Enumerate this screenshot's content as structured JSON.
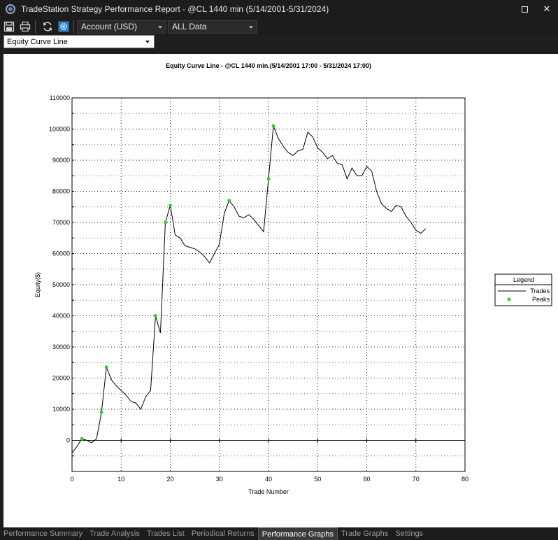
{
  "window": {
    "title": "TradeStation Strategy Performance Report - @CL 1440 min (5/14/2001-5/31/2024)",
    "maximize_icon": "maximize-icon",
    "close_glyph": "✕"
  },
  "toolbar": {
    "icons": [
      "save-icon",
      "print-icon",
      "refresh-icon",
      "settings-icon"
    ],
    "account_select": "Account (USD)",
    "data_range_select": "ALL Data"
  },
  "view_select": {
    "value": "Equity Curve Line"
  },
  "chart_data": {
    "type": "line",
    "title": "Equity Curve Line - @CL 1440 min.(5/14/2001 17:00 - 5/31/2024 17:00)",
    "xlabel": "Trade Number",
    "ylabel": "Equity($)",
    "xlim": [
      0,
      80
    ],
    "ylim": [
      -10000,
      110000
    ],
    "x_ticks": [
      0,
      10,
      20,
      30,
      40,
      50,
      60,
      70,
      80
    ],
    "y_ticks": [
      0,
      10000,
      20000,
      30000,
      40000,
      50000,
      60000,
      70000,
      80000,
      90000,
      100000,
      110000
    ],
    "grid": true,
    "legend": {
      "title": "Legend",
      "position": "right",
      "entries": [
        "Trades",
        "Peaks"
      ]
    },
    "colors": {
      "trades": "#000000",
      "peaks": "#33cc33"
    },
    "series": [
      {
        "name": "Trades",
        "x": [
          1,
          2,
          3,
          4,
          5,
          6,
          7,
          8,
          9,
          10,
          11,
          12,
          13,
          14,
          15,
          16,
          17,
          18,
          19,
          20,
          21,
          22,
          23,
          24,
          25,
          26,
          27,
          28,
          29,
          30,
          31,
          32,
          33,
          34,
          35,
          36,
          37,
          38,
          39,
          40,
          41,
          42,
          43,
          44,
          45,
          46,
          47,
          48,
          49,
          50,
          51,
          52,
          53,
          54,
          55,
          56,
          57,
          58,
          59,
          60,
          61,
          62,
          63,
          64,
          65,
          66,
          67,
          68,
          69,
          70,
          71,
          72
        ],
        "values": [
          -2000,
          500,
          0,
          -800,
          500,
          9000,
          23500,
          19500,
          17500,
          16000,
          14500,
          12500,
          12000,
          10000,
          14000,
          16000,
          40000,
          34500,
          70000,
          75500,
          66000,
          65000,
          62500,
          62000,
          61500,
          60500,
          59000,
          57000,
          60000,
          63000,
          73000,
          77000,
          75000,
          72000,
          71500,
          72500,
          71000,
          69000,
          67000,
          84000,
          101000,
          97000,
          94500,
          92500,
          91500,
          93000,
          93500,
          99000,
          97500,
          94000,
          92500,
          90500,
          91500,
          89000,
          88500,
          84000,
          87500,
          85000,
          85000,
          88000,
          86500,
          80000,
          76000,
          74500,
          73500,
          75500,
          75000,
          72000,
          70000,
          67500,
          66500,
          68000
        ]
      },
      {
        "name": "Peaks",
        "x": [
          2,
          6,
          7,
          17,
          19,
          20,
          32,
          40,
          41
        ],
        "values": [
          500,
          9000,
          23500,
          40000,
          70000,
          75500,
          77000,
          84000,
          101000
        ]
      }
    ]
  },
  "tabs": [
    {
      "label": "Performance Summary",
      "active": false
    },
    {
      "label": "Trade Analysis",
      "active": false
    },
    {
      "label": "Trades List",
      "active": false
    },
    {
      "label": "Periodical Returns",
      "active": false
    },
    {
      "label": "Performance Graphs",
      "active": true
    },
    {
      "label": "Trade Graphs",
      "active": false
    },
    {
      "label": "Settings",
      "active": false
    }
  ]
}
